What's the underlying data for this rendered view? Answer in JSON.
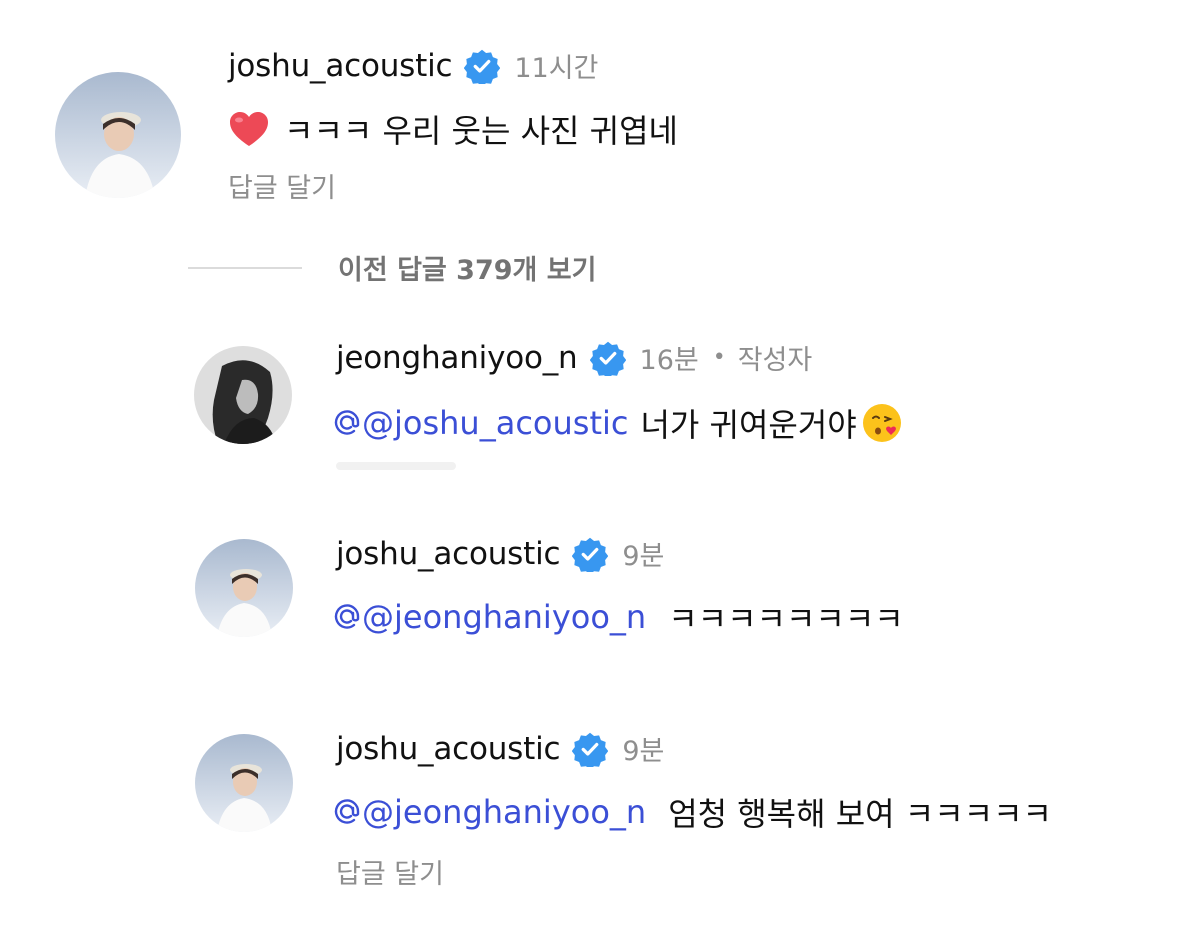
{
  "comments": [
    {
      "username": "joshu_acoustic",
      "time": "11시간",
      "text": "ㅋㅋㅋ 우리 웃는 사진 귀엽네",
      "reply_label": "답글 달기"
    },
    {
      "username": "jeonghaniyoo_n",
      "time": "16분",
      "author_tag": "작성자",
      "mention": "@joshu_acoustic",
      "text": "너가 귀여운거야"
    },
    {
      "username": "joshu_acoustic",
      "time": "9분",
      "mention": "@jeonghaniyoo_n",
      "text": "ㅋㅋㅋㅋㅋㅋㅋㅋ"
    },
    {
      "username": "joshu_acoustic",
      "time": "9분",
      "mention": "@jeonghaniyoo_n",
      "text": "엄청 행복해 보여 ㅋㅋㅋㅋㅋ",
      "reply_label": "답글 달기"
    }
  ],
  "view_replies_label": "이전 답글 379개 보기",
  "colors": {
    "verified": "#3897f0",
    "mention": "#3b4fd6",
    "muted": "#8e8e8e",
    "heart": "#ed4956"
  },
  "icons": {
    "verified": "verified-badge-icon",
    "heart": "red-heart-icon",
    "emoji": "face-blowing-kiss-emoji"
  }
}
